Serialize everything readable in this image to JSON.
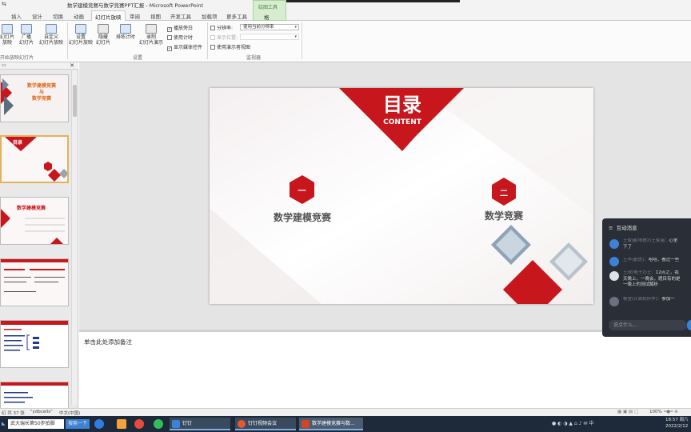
{
  "window": {
    "title": "数学建模竞赛与数学竞赛PPT汇报 - Microsoft PowerPoint",
    "quick_access": "⇆"
  },
  "tabs": [
    {
      "label": "插入"
    },
    {
      "label": "设计"
    },
    {
      "label": "切换"
    },
    {
      "label": "动画"
    },
    {
      "label": "幻灯片放映"
    },
    {
      "label": "审阅"
    },
    {
      "label": "视图"
    },
    {
      "label": "开发工具"
    },
    {
      "label": "加载项"
    },
    {
      "label": "更多工具"
    }
  ],
  "context_tab": {
    "group": "绘图工具",
    "label": "格"
  },
  "ribbon": {
    "start_show": {
      "btn1": "幻灯片",
      "btn1b": "放映",
      "btn2": "广播",
      "btn2b": "幻灯片",
      "btn3": "自定义",
      "btn3b": "幻灯片放映",
      "group": "开始放映幻灯片"
    },
    "setup": {
      "btn1": "设置",
      "btn1b": "幻灯片放映",
      "btn2": "隐藏",
      "btn2b": "幻灯片",
      "btn3": "排练计时",
      "btn4": "录制",
      "btn4b": "幻灯片演示",
      "chk1": "播放旁白",
      "chk2": "使用计时",
      "chk3": "显示媒体控件",
      "group": "设置"
    },
    "monitors": {
      "resolution_label": "分辨率:",
      "resolution_value": "使用当前分辨率",
      "display_label": "显示位置:",
      "display_value": "",
      "presenter": "使用演示者视图",
      "group": "监视器"
    }
  },
  "slide": {
    "title": "目录",
    "subtitle": "CONTENT",
    "item1_num": "一",
    "item1_text": "数学建模竞赛",
    "item2_num": "二",
    "item2_text": "数学竞赛"
  },
  "thumbnails": {
    "t1_title": "数学建模竞赛",
    "t1_and": "与",
    "t1_sub": "数学竞赛",
    "t2_title": "目录",
    "t3_title": "数学建模竞赛"
  },
  "notes": {
    "placeholder": "单击此处添加备注"
  },
  "status": {
    "slide": "幻 共 37 张",
    "theme": "\"ydbcells\"",
    "lang": "中文(中国)",
    "zoom": "100%"
  },
  "taskbar": {
    "start_search": "武大瑞长第50步拍脚",
    "search_btn": "搜索一下",
    "app1": "钉钉",
    "app2": "钉钉视频会议",
    "app3": "数学建模竞赛与数...",
    "time": "18:57 周六",
    "date": "2022/2/12"
  },
  "chat": {
    "header": "互动消息",
    "m1_name": "王俊涵(地理2)王俊涵：",
    "m1_text": "心里",
    "m1_text2": "下了",
    "m2_name": "王华(勤思)：",
    "m2_text": "哈哈，看过一些",
    "m3_name": "王欣(电子2)王：",
    "m3_text": "12点之，我",
    "m3_text2": "天晚上，一晚会，题目有的是",
    "m3_text3": "一晚上的测试解析",
    "m4_name": "杨莹(计算机科学)：",
    "m4_text": "参加一",
    "input_placeholder": "说点什么..."
  },
  "colors": {
    "accent_red": "#c8161d",
    "ribbon_bg": "#fbfbfb",
    "taskbar": "#1e2a3a"
  }
}
